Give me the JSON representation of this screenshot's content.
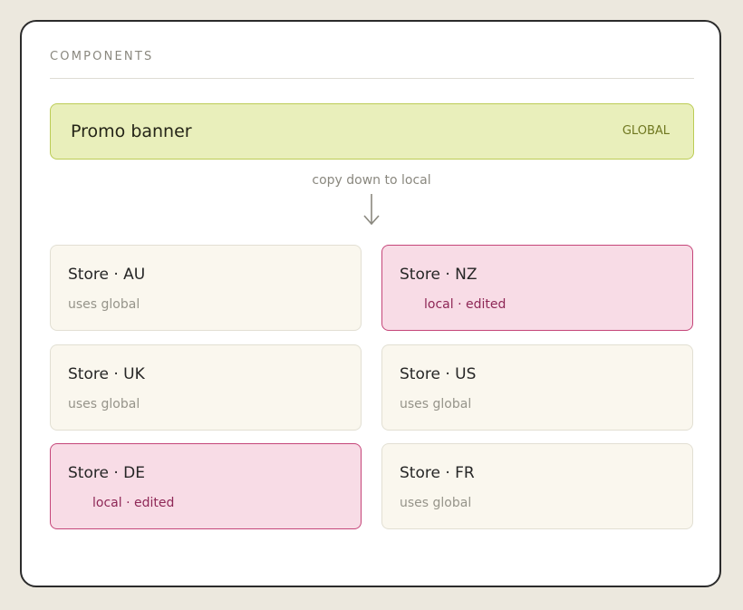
{
  "section": {
    "title": "COMPONENTS"
  },
  "banner": {
    "title": "Promo banner",
    "badge": "GLOBAL"
  },
  "flow": {
    "label": "copy down to local"
  },
  "stores": [
    {
      "name": "Store · AU",
      "status": "uses global",
      "edited": false
    },
    {
      "name": "Store · NZ",
      "status": "local · edited",
      "edited": true
    },
    {
      "name": "Store · UK",
      "status": "uses global",
      "edited": false
    },
    {
      "name": "Store · US",
      "status": "uses global",
      "edited": false
    },
    {
      "name": "Store · DE",
      "status": "local · edited",
      "edited": true
    },
    {
      "name": "Store · FR",
      "status": "uses global",
      "edited": false
    }
  ],
  "colors": {
    "global_fill": "#e9efbb",
    "global_border": "#bccc55",
    "edited_fill": "#f8dce6",
    "edited_border": "#c54579",
    "default_fill": "#faf7ee"
  }
}
